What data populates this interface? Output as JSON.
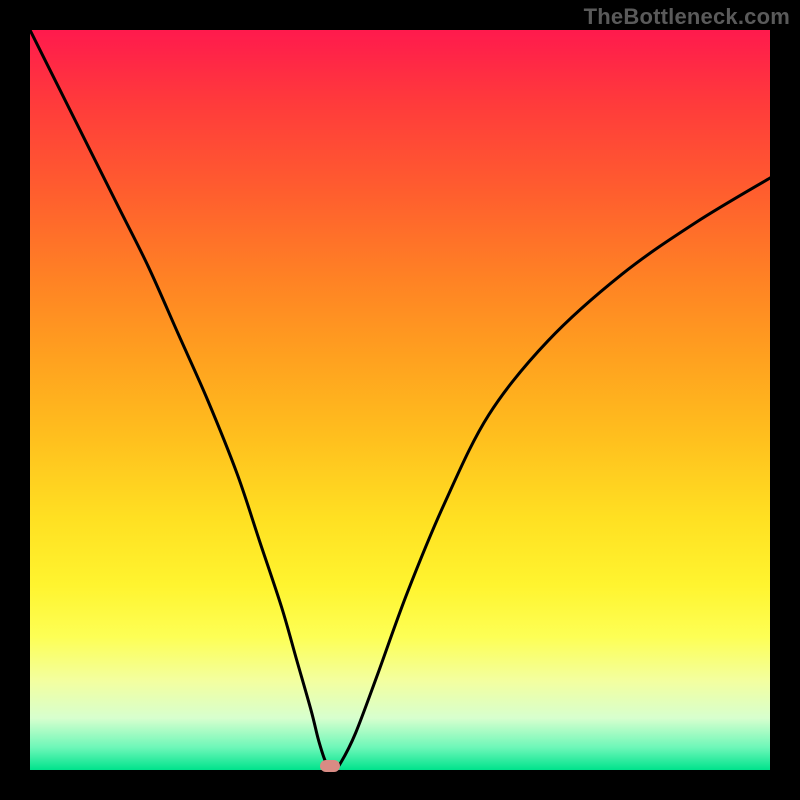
{
  "watermark": "TheBottleneck.com",
  "chart_data": {
    "type": "line",
    "title": "",
    "xlabel": "",
    "ylabel": "",
    "xlim": [
      0,
      100
    ],
    "ylim": [
      0,
      100
    ],
    "series": [
      {
        "name": "curve",
        "x": [
          0,
          4,
          8,
          12,
          16,
          20,
          24,
          28,
          31,
          34,
          36,
          38,
          39,
          40,
          41,
          42,
          44,
          47,
          51,
          56,
          62,
          70,
          80,
          90,
          100
        ],
        "y": [
          100,
          92,
          84,
          76,
          68,
          59,
          50,
          40,
          31,
          22,
          15,
          8,
          4,
          1,
          0,
          1,
          5,
          13,
          24,
          36,
          48,
          58,
          67,
          74,
          80
        ]
      }
    ],
    "marker": {
      "x": 40.5,
      "y": 0.5
    },
    "background_gradient": {
      "top": "#ff1a4d",
      "mid": "#ffe022",
      "bottom": "#00e38c"
    }
  }
}
